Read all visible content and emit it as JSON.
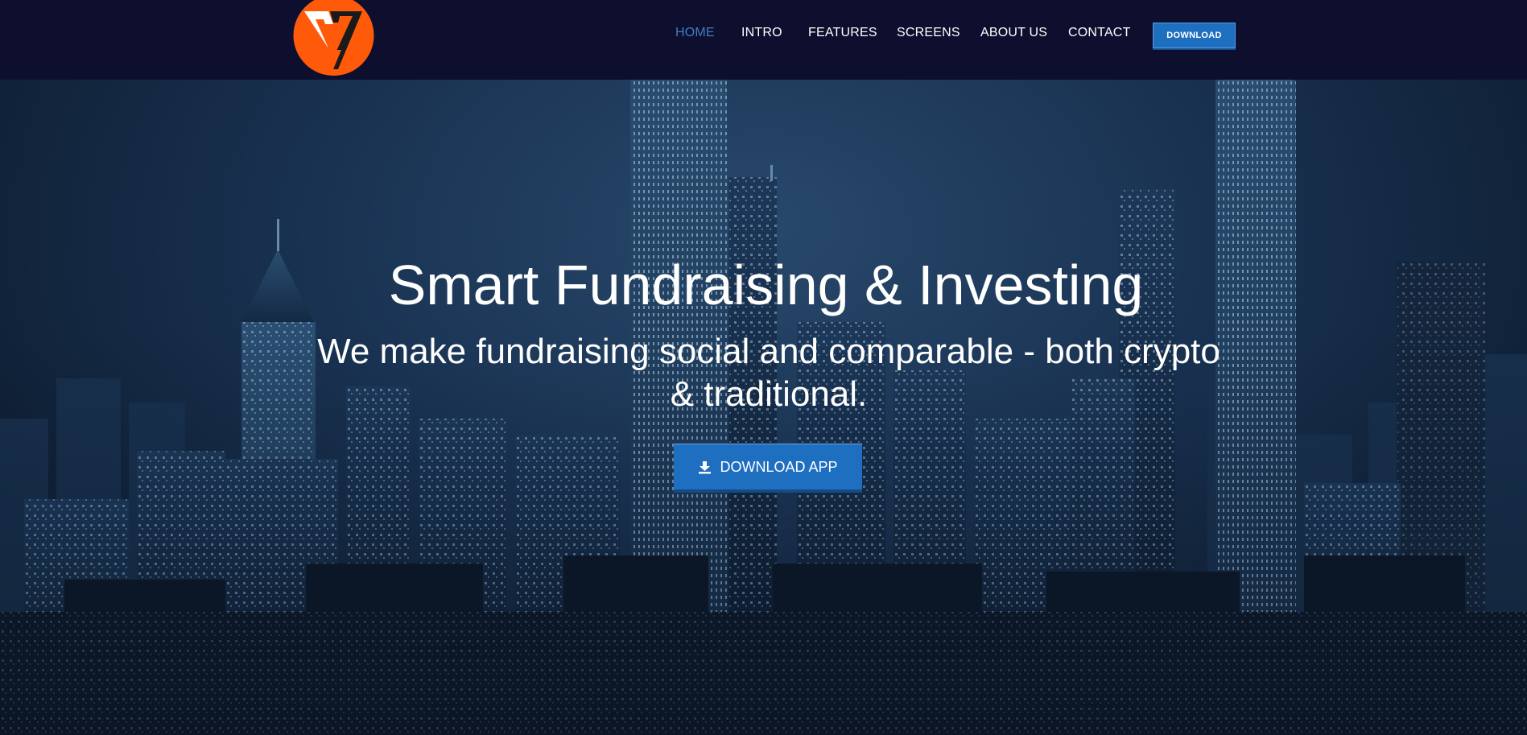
{
  "header": {
    "logo_name": "logo-icon",
    "nav": [
      {
        "label": "HOME",
        "active": true
      },
      {
        "label": "INTRO",
        "active": false
      },
      {
        "label": "FEATURES",
        "active": false
      },
      {
        "label": "SCREENS",
        "active": false
      },
      {
        "label": "ABOUT US",
        "active": false
      },
      {
        "label": "CONTACT",
        "active": false
      }
    ],
    "download_label": "DOWNLOAD"
  },
  "hero": {
    "title": "Smart Fundraising & Investing",
    "subtitle": "We make fundraising social and comparable - both crypto & traditional.",
    "cta_label": "DOWNLOAD APP",
    "cta_icon": "download-icon"
  },
  "colors": {
    "header_bg": "#0e0f2e",
    "accent": "#1f6fc0",
    "active_nav": "#3d7fc4",
    "logo_orange": "#ff5a0a"
  }
}
